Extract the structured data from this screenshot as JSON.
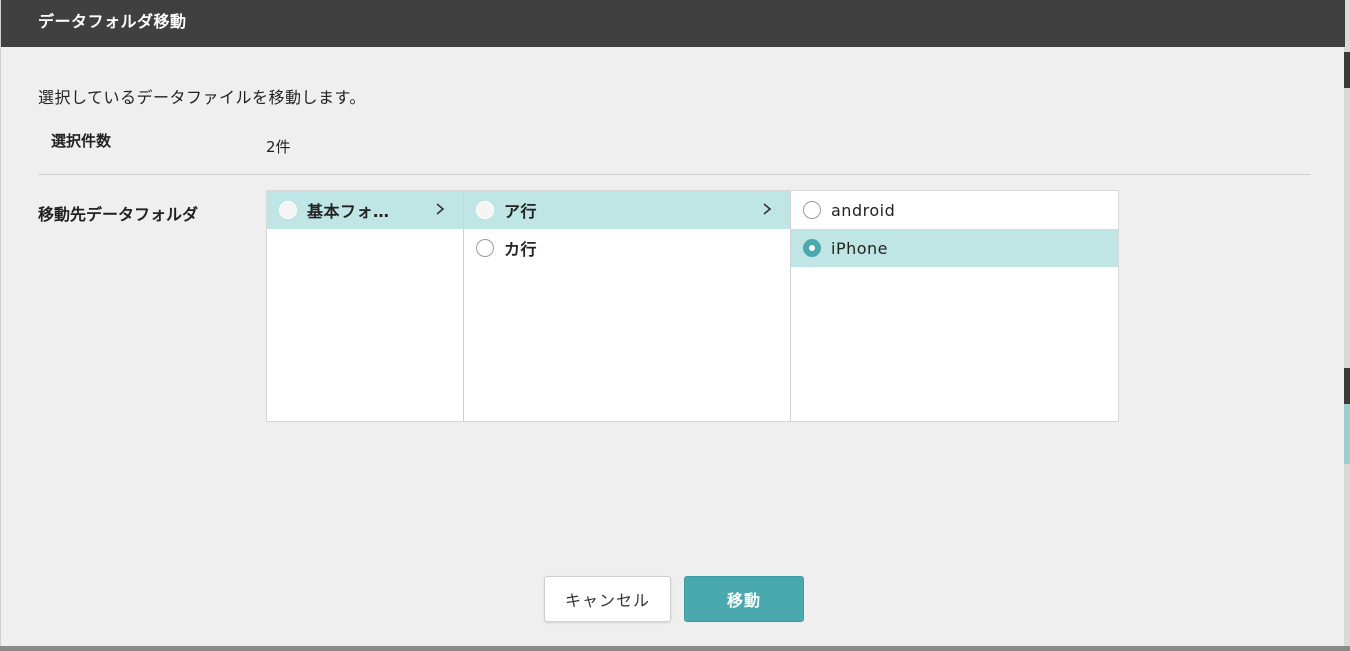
{
  "dialog": {
    "title": "データフォルダ移動",
    "description": "選択しているデータファイルを移動します。",
    "count_label": "選択件数",
    "count_value": "2件",
    "destination_label": "移動先データフォルダ"
  },
  "folder_browser": {
    "columns": [
      {
        "items": [
          {
            "label": "基本フォ…",
            "active": true,
            "has_children": true,
            "selected": false
          }
        ]
      },
      {
        "items": [
          {
            "label": "ア行",
            "active": true,
            "has_children": true,
            "selected": false
          },
          {
            "label": "カ行",
            "active": false,
            "has_children": false,
            "selected": false
          }
        ]
      },
      {
        "items": [
          {
            "label": "android",
            "active": false,
            "has_children": false,
            "selected": false
          },
          {
            "label": "iPhone",
            "active": true,
            "has_children": false,
            "selected": true
          }
        ]
      }
    ]
  },
  "buttons": {
    "cancel": "キャンセル",
    "move": "移動"
  },
  "colors": {
    "header_bg": "#404040",
    "accent": "#4aa9ae",
    "active_row": "#bfe5e5",
    "dialog_bg": "#efefef"
  }
}
